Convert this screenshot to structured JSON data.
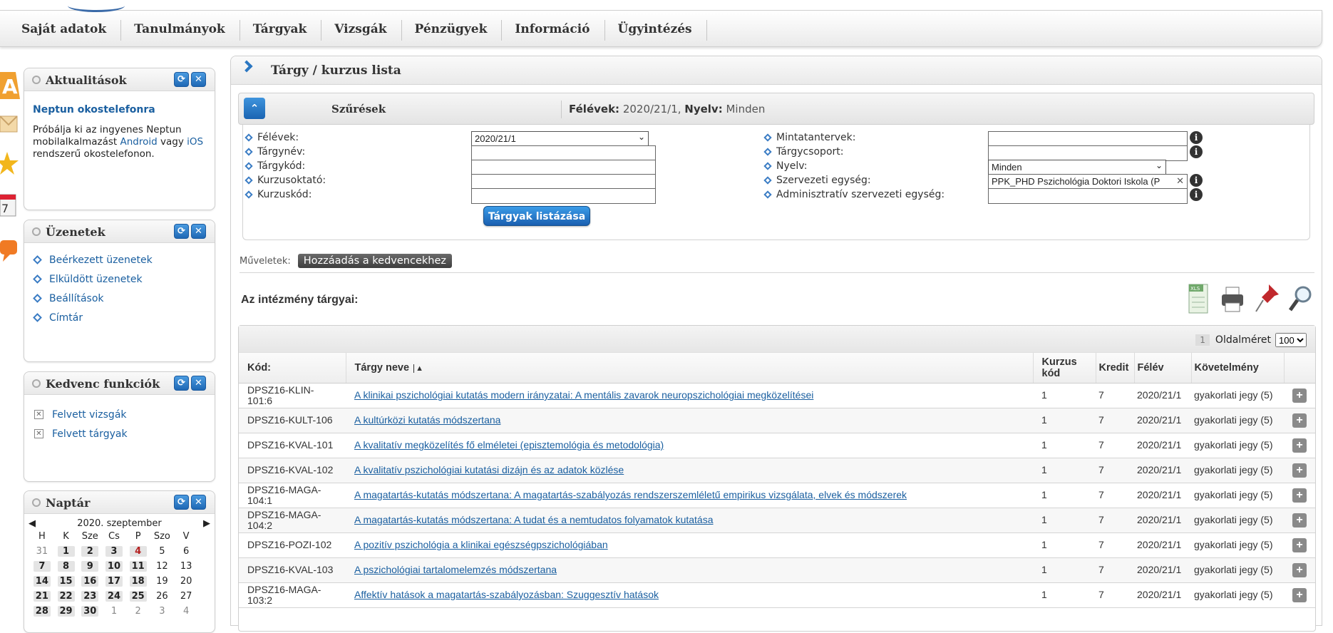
{
  "nav": [
    "Saját adatok",
    "Tanulmányok",
    "Tárgyak",
    "Vizsgák",
    "Pénzügyek",
    "Információ",
    "Ügyintézés"
  ],
  "sidebar": {
    "news": {
      "title": "Aktualitások",
      "item_title": "Neptun okostelefonra",
      "text_1": "Próbálja ki az ingyenes Neptun mobilalkalmazást ",
      "android": "Android",
      "text_2": " vagy ",
      "ios": "iOS",
      "text_3": " rendszerű okostelefonon."
    },
    "messages": {
      "title": "Üzenetek",
      "items": [
        "Beérkezett üzenetek",
        "Elküldött üzenetek",
        "Beállítások",
        "Címtár"
      ]
    },
    "favorites": {
      "title": "Kedvenc funkciók",
      "items": [
        "Felvett vizsgák",
        "Felvett tárgyak"
      ]
    },
    "calendar": {
      "title": "Naptár",
      "month": "2020. szeptember",
      "days": [
        "H",
        "K",
        "Sze",
        "Cs",
        "P",
        "Szo",
        "V"
      ],
      "weeks": [
        [
          "31",
          "1",
          "2",
          "3",
          "4",
          "5",
          "6"
        ],
        [
          "7",
          "8",
          "9",
          "10",
          "11",
          "12",
          "13"
        ],
        [
          "14",
          "15",
          "16",
          "17",
          "18",
          "19",
          "20"
        ],
        [
          "21",
          "22",
          "23",
          "24",
          "25",
          "26",
          "27"
        ],
        [
          "28",
          "29",
          "30",
          "1",
          "2",
          "3",
          "4"
        ]
      ]
    }
  },
  "main": {
    "title": "Tárgy / kurzus lista",
    "filter": {
      "label": "Szűrések",
      "summary_felevek_label": "Félévek:",
      "summary_felevek_value": " 2020/21/1, ",
      "summary_nyelv_label": "Nyelv:",
      "summary_nyelv_value": " Minden",
      "left_fields": [
        "Félévek:",
        "Tárgynév:",
        "Tárgykód:",
        "Kurzusoktató:",
        "Kurzuskód:"
      ],
      "right_fields": [
        "Mintatantervek:",
        "Tárgycsoport:",
        "Nyelv:",
        "Szervezeti egység:",
        "Adminisztratív szervezeti egység:"
      ],
      "semester_value": "2020/21/1",
      "language_value": "Minden",
      "org_unit_value": "PPK_PHD Pszichológia Doktori Iskola (P",
      "list_button": "Tárgyak listázása"
    },
    "operations_label": "Műveletek:",
    "favorite_button": "Hozzáadás a kedvencekhez",
    "institution_title": "Az intézmény tárgyai:",
    "pager": {
      "page": "1",
      "page_size_label": "Oldalméret",
      "page_size": "100"
    },
    "columns": {
      "code": "Kód:",
      "name": "Tárgy neve",
      "course_code": "Kurzus kód",
      "credit": "Kredit",
      "semester": "Félév",
      "requirement": "Követelmény"
    },
    "rows": [
      {
        "code": "DPSZ16-KLIN-101:6",
        "name": "A klinikai pszichológiai kutatás modern irányzatai: A mentális zavarok neuropszichológiai megközelítései",
        "course": "1",
        "credit": "7",
        "semester": "2020/21/1",
        "req": "gyakorlati jegy (5)"
      },
      {
        "code": "DPSZ16-KULT-106",
        "name": "A kultúrközi kutatás módszertana",
        "course": "1",
        "credit": "7",
        "semester": "2020/21/1",
        "req": "gyakorlati jegy (5)"
      },
      {
        "code": "DPSZ16-KVAL-101",
        "name": "A kvalitatív megközelítés fő elméletei (episztemológia és metodológia)",
        "course": "1",
        "credit": "7",
        "semester": "2020/21/1",
        "req": "gyakorlati jegy (5)"
      },
      {
        "code": "DPSZ16-KVAL-102",
        "name": "A kvalitatív pszichológiai kutatási dizájn és az adatok közlése",
        "course": "1",
        "credit": "7",
        "semester": "2020/21/1",
        "req": "gyakorlati jegy (5)"
      },
      {
        "code": "DPSZ16-MAGA-104:1",
        "name": "A magatartás-kutatás módszertana: A magatartás-szabályozás rendszerszemléletű empirikus vizsgálata, elvek és módszerek",
        "course": "1",
        "credit": "7",
        "semester": "2020/21/1",
        "req": "gyakorlati jegy (5)"
      },
      {
        "code": "DPSZ16-MAGA-104:2",
        "name": "A magatartás-kutatás módszertana: A tudat és a nemtudatos folyamatok kutatása",
        "course": "1",
        "credit": "7",
        "semester": "2020/21/1",
        "req": "gyakorlati jegy (5)"
      },
      {
        "code": "DPSZ16-POZI-102",
        "name": "A pozitív pszichológia a klinikai egészségpszichológiában",
        "course": "1",
        "credit": "7",
        "semester": "2020/21/1",
        "req": "gyakorlati jegy (5)"
      },
      {
        "code": "DPSZ16-KVAL-103",
        "name": "A pszichológiai tartalomelemzés módszertana",
        "course": "1",
        "credit": "7",
        "semester": "2020/21/1",
        "req": "gyakorlati jegy (5)"
      },
      {
        "code": "DPSZ16-MAGA-103:2",
        "name": "Affektív hatások a magatartás-szabályozásban: Szuggesztív hatások",
        "course": "1",
        "credit": "7",
        "semester": "2020/21/1",
        "req": "gyakorlati jegy (5)"
      }
    ]
  }
}
